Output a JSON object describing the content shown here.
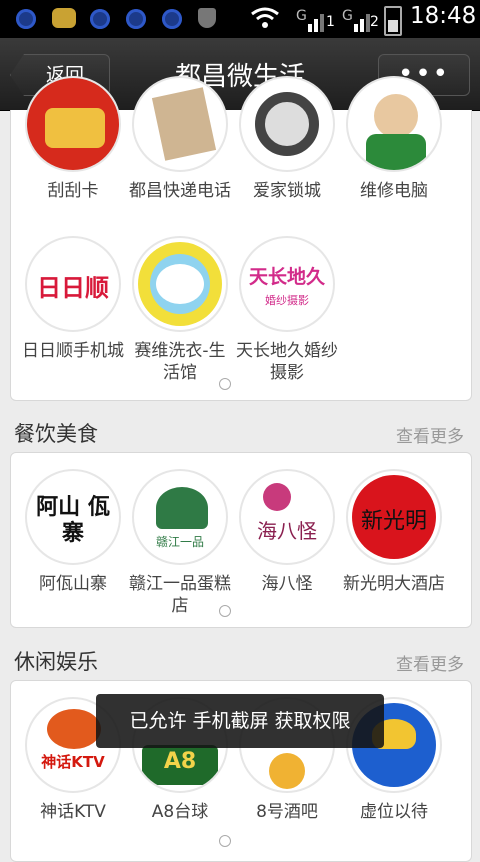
{
  "status_bar": {
    "time": "18:48",
    "sim1": "1",
    "sim2": "2"
  },
  "header": {
    "back_label": "返回",
    "title": "都昌微生活",
    "more_label": "•••"
  },
  "sections": {
    "top": {
      "items": [
        {
          "label": "刮刮卡",
          "icon": "lottery-icon"
        },
        {
          "label": "都昌快递电话",
          "icon": "express-box-icon"
        },
        {
          "label": "爱家锁城",
          "icon": "lock-ring-icon"
        },
        {
          "label": "维修电脑",
          "icon": "technician-icon"
        },
        {
          "label": "日日顺手机城",
          "icon": "ririshun-logo-icon",
          "logo_text": "日日顺"
        },
        {
          "label": "赛维洗衣-生活馆",
          "icon": "saiwei-logo-icon"
        },
        {
          "label": "天长地久婚纱摄影",
          "icon": "wedding-logo-icon",
          "logo_text": "天长地久",
          "logo_sub": "婚纱摄影"
        }
      ]
    },
    "food": {
      "title": "餐饮美食",
      "more": "查看更多",
      "items": [
        {
          "label": "阿佤山寨",
          "icon": "awashanzhai-logo-icon",
          "logo_text": "阿山 佤寨"
        },
        {
          "label": "赣江一品蛋糕店",
          "icon": "cake-shop-logo-icon",
          "logo_text": "赣江一品"
        },
        {
          "label": "海八怪",
          "icon": "haibaguai-logo-icon",
          "logo_text": "海八怪"
        },
        {
          "label": "新光明大酒店",
          "icon": "hotel-logo-icon",
          "logo_text": "新光明"
        }
      ]
    },
    "leisure": {
      "title": "休闲娱乐",
      "more": "查看更多",
      "items": [
        {
          "label": "神话KTV",
          "icon": "ktv-logo-icon",
          "logo_text": "神话KTV"
        },
        {
          "label": "A8台球",
          "icon": "billiards-logo-icon",
          "logo_text": "A8"
        },
        {
          "label": "8号酒吧",
          "icon": "bar-logo-icon"
        },
        {
          "label": "虚位以待",
          "icon": "placeholder-logo-icon"
        }
      ]
    }
  },
  "toast": "已允许 手机截屏 获取权限"
}
